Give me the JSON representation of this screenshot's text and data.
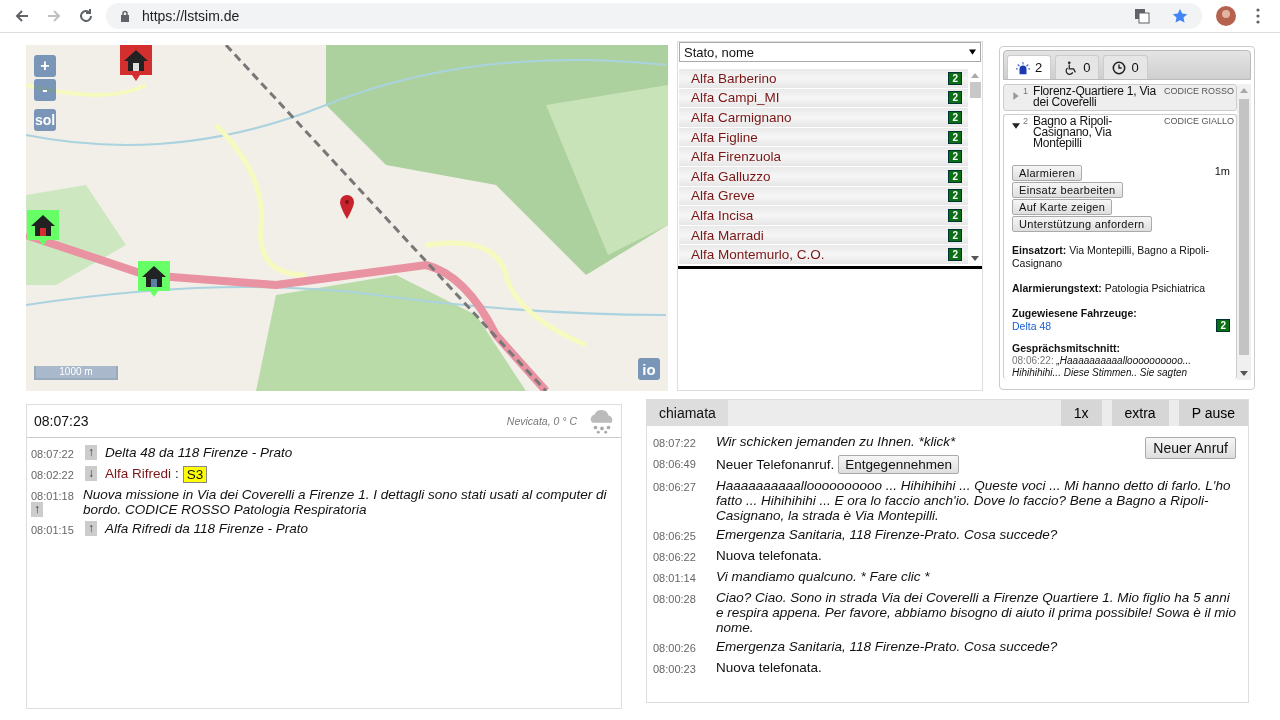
{
  "browser": {
    "url": "https://lstsim.de"
  },
  "map": {
    "kind": "picture",
    "zoom_in": "+",
    "zoom_out": "-",
    "layer_button": "sol",
    "info_button": "io",
    "scale": "1000 m"
  },
  "vehicle_list": {
    "sort": "Stato, nome",
    "items": [
      {
        "name": "Alfa Barberino",
        "status": "2"
      },
      {
        "name": "Alfa Campi_MI",
        "status": "2"
      },
      {
        "name": "Alfa Carmignano",
        "status": "2"
      },
      {
        "name": "Alfa Figline",
        "status": "2"
      },
      {
        "name": "Alfa Firenzuola",
        "status": "2"
      },
      {
        "name": "Alfa Galluzzo",
        "status": "2"
      },
      {
        "name": "Alfa Greve",
        "status": "2"
      },
      {
        "name": "Alfa Incisa",
        "status": "2"
      },
      {
        "name": "Alfa Marradi",
        "status": "2"
      },
      {
        "name": "Alfa Montemurlo, C.O.",
        "status": "2"
      }
    ]
  },
  "missions": {
    "tabs": [
      {
        "kind": "emergency",
        "count": "2",
        "selected": true
      },
      {
        "kind": "patient",
        "count": "0",
        "selected": false
      },
      {
        "kind": "waiting",
        "count": "0",
        "selected": false
      }
    ],
    "items": [
      {
        "number": "1",
        "title": "Florenz-Quartiere 1, Via dei Coverelli",
        "code": "CODICE ROSSO",
        "expanded": false
      },
      {
        "number": "2",
        "title": "Bagno a Ripoli-Casignano, Via Montepilli",
        "code": "CODICE GIALLO",
        "expanded": true,
        "buttons": [
          "Alarmieren",
          "Einsatz bearbeiten",
          "Auf Karte zeigen",
          "Unterstützung anfordern"
        ],
        "age": "1m",
        "details": [
          {
            "label": "Einsatzort:",
            "value": "Via Montepilli, Bagno a Ripoli-Casignano"
          },
          {
            "label": "Alarmierungstext:",
            "value": "Patologia Psichiatrica"
          }
        ],
        "vehicles_label": "Zugewiesene Fahrzeuge:",
        "vehicles": [
          {
            "name": "Delta 48",
            "status": "2"
          }
        ],
        "transcript_label": "Gesprächsmitschnitt:",
        "transcript_time": "08:06:22:",
        "transcript_text": "„Haaaaaaaaaalloooooooooo... Hihihihihi... Diese Stimmen.. Sie sagten"
      }
    ]
  },
  "event_log": {
    "clock": "08:07:23",
    "weather": "Nevicata, 0 ° C",
    "rows": [
      {
        "time": "08:07:22",
        "direction": "↑",
        "kind": "message",
        "text": "Delta 48 da 118 Firenze - Prato"
      },
      {
        "time": "08:02:22",
        "direction": "↓",
        "kind": "status",
        "vehicle": "Alfa Rifredi",
        "separator": ":",
        "status": "S3"
      },
      {
        "time": "08:01:18",
        "direction": "↑",
        "kind": "wrapped",
        "text": "Nuova missione in Via dei Coverelli a Firenze 1. I dettagli sono stati usati al computer di bordo. CODICE ROSSO Patologia Respiratoria"
      },
      {
        "time": "08:01:15",
        "direction": "↑",
        "kind": "message",
        "text": "Alfa Rifredi da 118 Firenze - Prato"
      }
    ]
  },
  "call_panel": {
    "title": "chiamata",
    "controls": [
      "1x",
      "extra",
      "P ause"
    ],
    "new_call_button": "Neuer Anruf",
    "rows": [
      {
        "time": "08:07:22",
        "kind": "speech",
        "text": "Wir schicken jemanden zu Ihnen. *klick*"
      },
      {
        "time": "08:06:49",
        "kind": "incoming",
        "text": "Neuer Telefonanruf.",
        "button": "Entgegennehmen"
      },
      {
        "time": "08:06:27",
        "kind": "speech",
        "text": "Haaaaaaaaaalloooooooooo ... Hihihihihi ... Queste voci ... Mi hanno detto di farlo. L'ho fatto ... Hihihihihi ... E ora lo faccio anch'io. Dove lo faccio? Bene a Bagno a Ripoli-Casignano, la strada è Via Montepilli."
      },
      {
        "time": "08:06:25",
        "kind": "speech",
        "text": "Emergenza Sanitaria, 118 Firenze-Prato. Cosa succede?"
      },
      {
        "time": "08:06:22",
        "kind": "system",
        "text": "Nuova telefonata."
      },
      {
        "time": "08:01:14",
        "kind": "speech",
        "text": "Vi mandiamo qualcuno. * Fare clic *"
      },
      {
        "time": "08:00:28",
        "kind": "speech",
        "text": "Ciao? Ciao. Sono in strada Via dei Coverelli a Firenze Quartiere 1. Mio figlio ha 5 anni e respira appena. Per favore, abbiamo bisogno di aiuto il prima possibile! Sowa è il mio nome."
      },
      {
        "time": "08:00:26",
        "kind": "speech",
        "text": "Emergenza Sanitaria, 118 Firenze-Prato. Cosa succede?"
      },
      {
        "time": "08:00:23",
        "kind": "system",
        "text": "Nuova telefonata."
      }
    ]
  }
}
